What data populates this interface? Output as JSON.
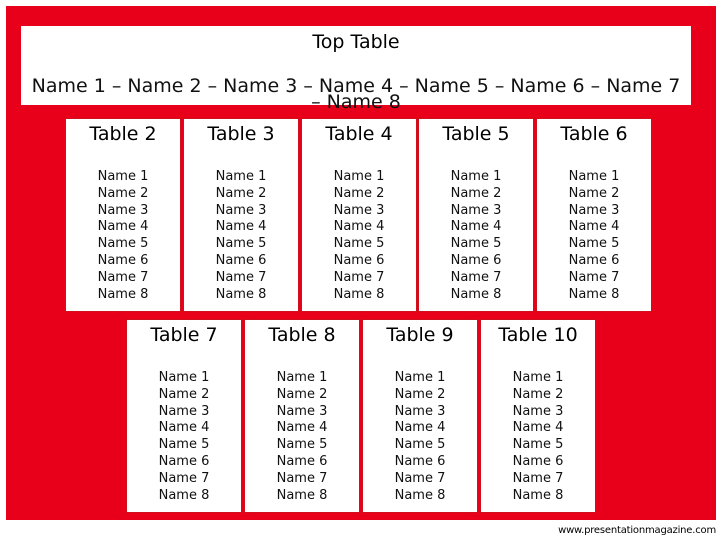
{
  "top_table": {
    "title": "Top Table",
    "names": "Name 1 – Name 2 – Name 3 – Name 4 – Name 5 – Name 6 – Name 7 – Name 8"
  },
  "tables": [
    {
      "title": "Table 2",
      "names": [
        "Name 1",
        "Name 2",
        "Name 3",
        "Name 4",
        "Name 5",
        "Name 6",
        "Name 7",
        "Name 8"
      ]
    },
    {
      "title": "Table 3",
      "names": [
        "Name 1",
        "Name 2",
        "Name 3",
        "Name 4",
        "Name 5",
        "Name 6",
        "Name 7",
        "Name 8"
      ]
    },
    {
      "title": "Table 4",
      "names": [
        "Name 1",
        "Name 2",
        "Name 3",
        "Name 4",
        "Name 5",
        "Name 6",
        "Name 7",
        "Name 8"
      ]
    },
    {
      "title": "Table 5",
      "names": [
        "Name 1",
        "Name 2",
        "Name 3",
        "Name 4",
        "Name 5",
        "Name 6",
        "Name 7",
        "Name 8"
      ]
    },
    {
      "title": "Table 6",
      "names": [
        "Name 1",
        "Name 2",
        "Name 3",
        "Name 4",
        "Name 5",
        "Name 6",
        "Name 7",
        "Name 8"
      ]
    },
    {
      "title": "Table 7",
      "names": [
        "Name 1",
        "Name 2",
        "Name 3",
        "Name 4",
        "Name 5",
        "Name 6",
        "Name 7",
        "Name 8"
      ]
    },
    {
      "title": "Table 8",
      "names": [
        "Name 1",
        "Name 2",
        "Name 3",
        "Name 4",
        "Name 5",
        "Name 6",
        "Name 7",
        "Name 8"
      ]
    },
    {
      "title": "Table 9",
      "names": [
        "Name 1",
        "Name 2",
        "Name 3",
        "Name 4",
        "Name 5",
        "Name 6",
        "Name 7",
        "Name 8"
      ]
    },
    {
      "title": "Table 10",
      "names": [
        "Name 1",
        "Name 2",
        "Name 3",
        "Name 4",
        "Name 5",
        "Name 6",
        "Name 7",
        "Name 8"
      ]
    }
  ],
  "footer": "www.presentationmagazine.com",
  "colors": {
    "background": "#e8001a",
    "box_border": "#d0101c",
    "box_fill": "#ffffff"
  }
}
